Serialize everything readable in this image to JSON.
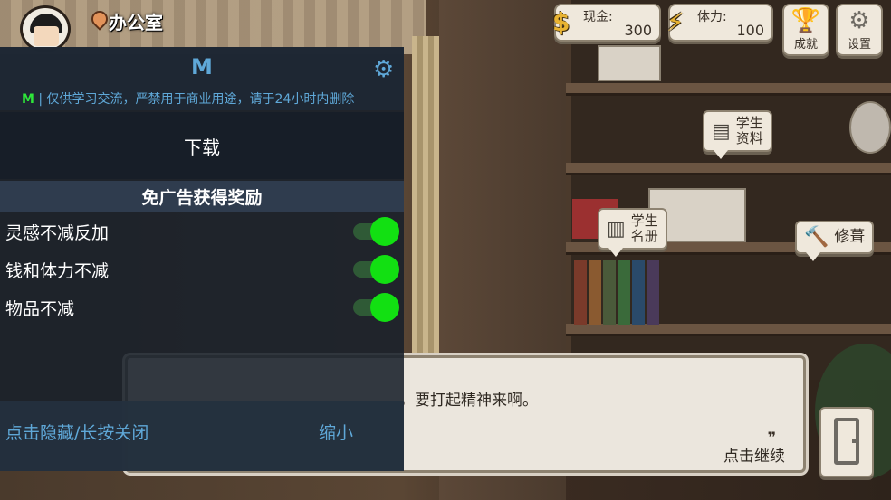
{
  "hud": {
    "location": "办公室",
    "cash_label": "现金:",
    "cash_value": "300",
    "stamina_label": "体力:",
    "stamina_value": "100",
    "achievements_label": "成就",
    "settings_label": "设置"
  },
  "shelf_tags": {
    "student_profile": [
      "学生",
      "资料"
    ],
    "student_roster": [
      "学生",
      "名册"
    ],
    "repair": "修葺"
  },
  "dialog": {
    "text": "，要打起精神来啊。",
    "quote_mark": "❞",
    "continue_label": "点击继续"
  },
  "mod_menu": {
    "title": "M",
    "notice_prefix": "M",
    "notice_text": " | 仅供学习交流，严禁用于商业用途，请于24小时内删除",
    "download_label": "下载",
    "section_title": "免广告获得奖励",
    "toggles": [
      {
        "label": "灵感不减反加",
        "on": true
      },
      {
        "label": "钱和体力不减",
        "on": true
      },
      {
        "label": "物品不减",
        "on": true
      }
    ],
    "hide_label": "点击隐藏/长按关闭",
    "shrink_label": "缩小"
  },
  "colors": {
    "mod_accent": "#5fa8d8",
    "toggle_on": "#12e012",
    "notice_m": "#2ee63a"
  },
  "icons": {
    "cash": "dollar-coin-icon",
    "stamina": "lightning-icon",
    "achievements": "trophy-icon",
    "settings": "gear-icon",
    "mod_settings": "gear-icon",
    "location": "map-pin-icon",
    "repair": "hammer-icon",
    "exit": "door-icon"
  }
}
